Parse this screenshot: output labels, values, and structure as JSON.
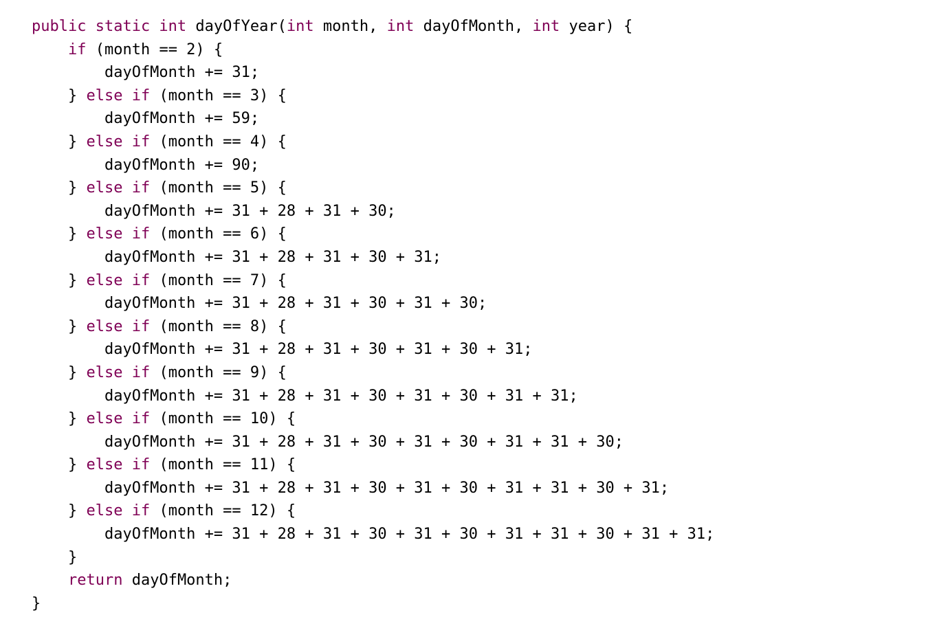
{
  "code": {
    "lines": [
      [
        {
          "t": "public static int",
          "k": true
        },
        {
          "t": " dayOfYear("
        },
        {
          "t": "int",
          "k": true
        },
        {
          "t": " month, "
        },
        {
          "t": "int",
          "k": true
        },
        {
          "t": " dayOfMonth, "
        },
        {
          "t": "int",
          "k": true
        },
        {
          "t": " year) {"
        }
      ],
      [
        {
          "t": "    "
        },
        {
          "t": "if",
          "k": true
        },
        {
          "t": " (month == 2) {"
        }
      ],
      [
        {
          "t": "        dayOfMonth += 31;"
        }
      ],
      [
        {
          "t": "    } "
        },
        {
          "t": "else if",
          "k": true
        },
        {
          "t": " (month == 3) {"
        }
      ],
      [
        {
          "t": "        dayOfMonth += 59;"
        }
      ],
      [
        {
          "t": "    } "
        },
        {
          "t": "else if",
          "k": true
        },
        {
          "t": " (month == 4) {"
        }
      ],
      [
        {
          "t": "        dayOfMonth += 90;"
        }
      ],
      [
        {
          "t": "    } "
        },
        {
          "t": "else if",
          "k": true
        },
        {
          "t": " (month == 5) {"
        }
      ],
      [
        {
          "t": "        dayOfMonth += 31 + 28 + 31 + 30;"
        }
      ],
      [
        {
          "t": "    } "
        },
        {
          "t": "else if",
          "k": true
        },
        {
          "t": " (month == 6) {"
        }
      ],
      [
        {
          "t": "        dayOfMonth += 31 + 28 + 31 + 30 + 31;"
        }
      ],
      [
        {
          "t": "    } "
        },
        {
          "t": "else if",
          "k": true
        },
        {
          "t": " (month == 7) {"
        }
      ],
      [
        {
          "t": "        dayOfMonth += 31 + 28 + 31 + 30 + 31 + 30;"
        }
      ],
      [
        {
          "t": "    } "
        },
        {
          "t": "else if",
          "k": true
        },
        {
          "t": " (month == 8) {"
        }
      ],
      [
        {
          "t": "        dayOfMonth += 31 + 28 + 31 + 30 + 31 + 30 + 31;"
        }
      ],
      [
        {
          "t": "    } "
        },
        {
          "t": "else if",
          "k": true
        },
        {
          "t": " (month == 9) {"
        }
      ],
      [
        {
          "t": "        dayOfMonth += 31 + 28 + 31 + 30 + 31 + 30 + 31 + 31;"
        }
      ],
      [
        {
          "t": "    } "
        },
        {
          "t": "else if",
          "k": true
        },
        {
          "t": " (month == 10) {"
        }
      ],
      [
        {
          "t": "        dayOfMonth += 31 + 28 + 31 + 30 + 31 + 30 + 31 + 31 + 30;"
        }
      ],
      [
        {
          "t": "    } "
        },
        {
          "t": "else if",
          "k": true
        },
        {
          "t": " (month == 11) {"
        }
      ],
      [
        {
          "t": "        dayOfMonth += 31 + 28 + 31 + 30 + 31 + 30 + 31 + 31 + 30 + 31;"
        }
      ],
      [
        {
          "t": "    } "
        },
        {
          "t": "else if",
          "k": true
        },
        {
          "t": " (month == 12) {"
        }
      ],
      [
        {
          "t": "        dayOfMonth += 31 + 28 + 31 + 30 + 31 + 30 + 31 + 31 + 30 + 31 + 31;"
        }
      ],
      [
        {
          "t": "    }"
        }
      ],
      [
        {
          "t": "    "
        },
        {
          "t": "return",
          "k": true
        },
        {
          "t": " dayOfMonth;"
        }
      ],
      [
        {
          "t": "}"
        }
      ]
    ]
  },
  "colors": {
    "keyword": "#7f0055",
    "text": "#000000",
    "background": "#ffffff"
  }
}
